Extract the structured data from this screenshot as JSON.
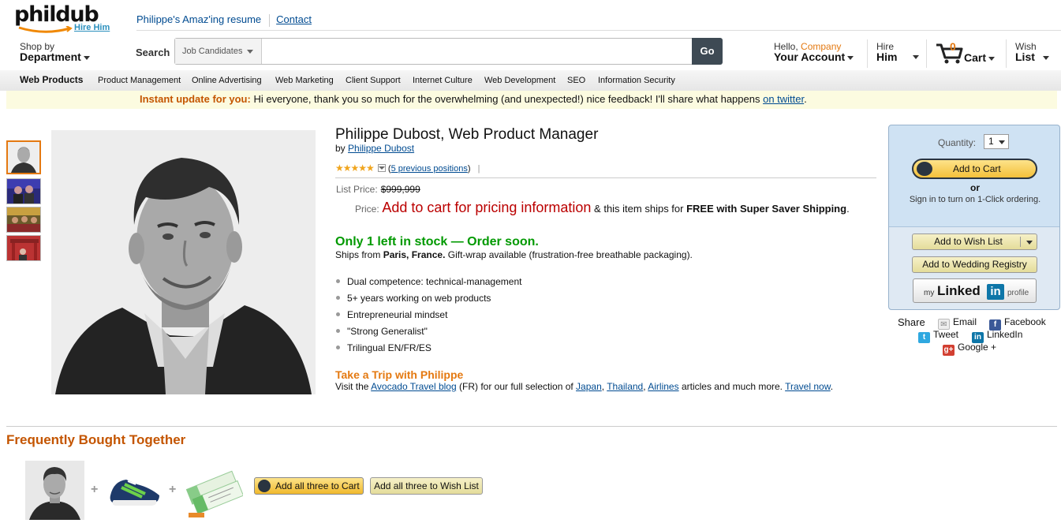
{
  "header": {
    "logo": "phildub",
    "logo_tag": "Hire Him",
    "resume_link": "Philippe's Amaz'ing resume",
    "contact_link": "Contact"
  },
  "nav": {
    "shop_by_small": "Shop by",
    "shop_by_big": "Department",
    "search_label": "Search",
    "search_category": "Job Candidates",
    "search_value": "",
    "go": "Go",
    "hello": "Hello,",
    "company": "Company",
    "your_account": "Your Account",
    "hire_small": "Hire",
    "hire_big": "Him",
    "cart_count": "0",
    "cart_label": "Cart",
    "wish_small": "Wish",
    "wish_big": "List"
  },
  "categories": [
    "Web Products",
    "Product Management",
    "Online Advertising",
    "Web Marketing",
    "Client Support",
    "Internet Culture",
    "Web Development",
    "SEO",
    "Information Security"
  ],
  "banner": {
    "lead": "Instant update for you:",
    "text": " Hi everyone, thank you so much for the overwhelming (and unexpected!) nice feedback! I'll share what happens ",
    "link": "on twitter",
    "tail": "."
  },
  "product": {
    "title": "Philippe Dubost, Web Product Manager",
    "by": "by",
    "author": "Philippe Dubost",
    "stars": "★★★★★",
    "rating_link": "5 previous positions",
    "list_price_label": "List Price:",
    "list_price": "$999,999",
    "price_label": "Price:",
    "price_red": "Add to cart for pricing information",
    "price_rest": " & this item ships for ",
    "price_bold": "FREE with Super Saver Shipping",
    "price_end": ".",
    "stock": "Only 1 left in stock — Order soon.",
    "ships_from": "Ships from ",
    "ships_place": "Paris, France.",
    "ships_rest": " Gift-wrap available (frustration-free breathable packaging).",
    "bullets": [
      "Dual competence: technical-management",
      "5+ years working on web products",
      "Entrepreneurial mindset",
      "\"Strong Generalist\"",
      "Trilingual EN/FR/ES"
    ],
    "trip_title": "Take a Trip with Philippe",
    "trip_pre": "Visit the ",
    "trip_blog": "Avocado Travel blog",
    "trip_mid": " (FR) for our full selection of ",
    "trip_japan": "Japan",
    "trip_comma1": ", ",
    "trip_thailand": "Thailand",
    "trip_comma2": ", ",
    "trip_airlines": "Airlines",
    "trip_after": " articles and much more. ",
    "trip_now": "Travel now",
    "trip_end": "."
  },
  "buybox": {
    "quantity_label": "Quantity:",
    "quantity": "1",
    "add_to_cart": "Add to Cart",
    "or": "or",
    "one_click": "Sign in to turn on 1-Click ordering.",
    "wish_list": "Add to Wish List",
    "wedding": "Add to Wedding Registry",
    "li_my": "my",
    "li_linked": "Linked",
    "li_in": "in",
    "li_profile": "profile"
  },
  "share": {
    "label": "Share",
    "email": "Email",
    "facebook": "Facebook",
    "tweet": "Tweet",
    "linkedin": "LinkedIn",
    "google": "Google +"
  },
  "fbt": {
    "title": "Frequently Bought Together",
    "plus": "+",
    "add_all_cart": "Add all three to Cart",
    "add_all_wish": "Add all three to Wish List"
  },
  "colors": {
    "accent_orange": "#e47911",
    "link_blue": "#004b91",
    "price_red": "#b00000",
    "stock_green": "#009900",
    "buybox_blue": "#cfe2f3"
  }
}
